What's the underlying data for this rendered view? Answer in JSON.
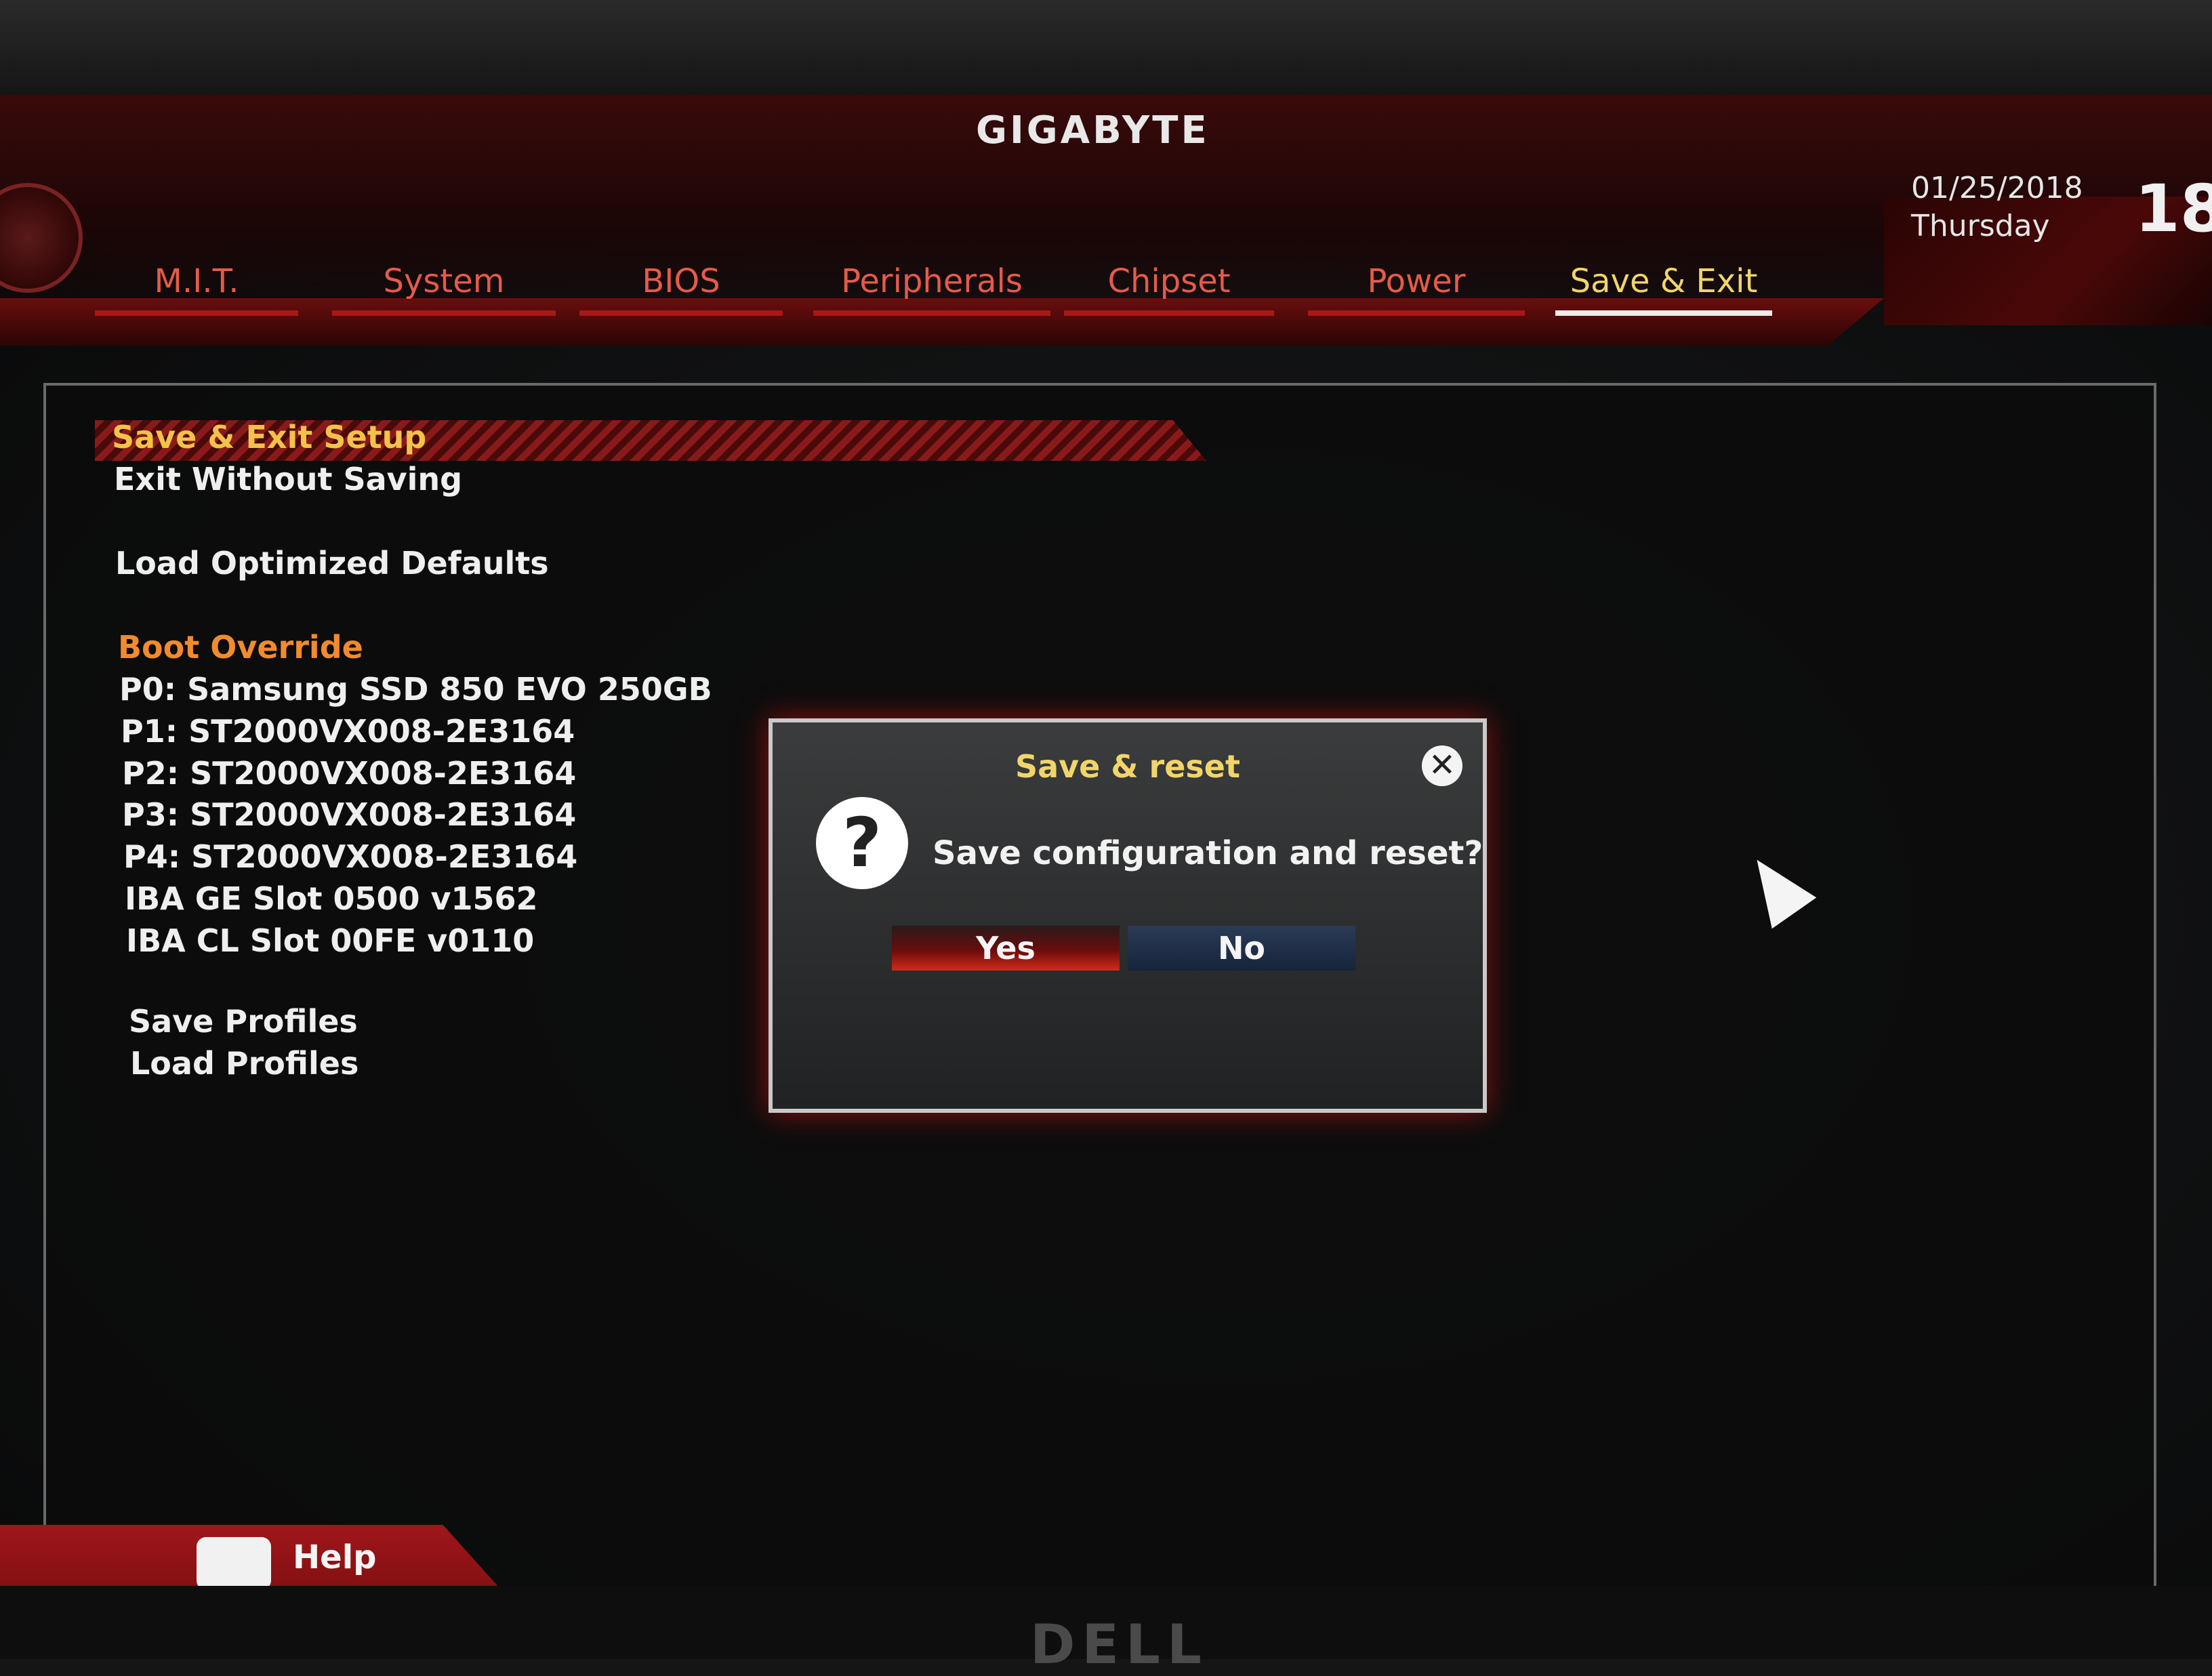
{
  "header": {
    "logo": "GIGABYTE",
    "date": "01/25/2018",
    "day": "Thursday",
    "time_fragment": "18"
  },
  "tabs": [
    {
      "label": "M.I.T."
    },
    {
      "label": "System"
    },
    {
      "label": "BIOS"
    },
    {
      "label": "Peripherals"
    },
    {
      "label": "Chipset"
    },
    {
      "label": "Power"
    },
    {
      "label": "Save & Exit"
    }
  ],
  "menu": {
    "save_exit_setup": "Save & Exit Setup",
    "exit_without_saving": "Exit Without Saving",
    "load_optimized_defaults": "Load Optimized Defaults",
    "boot_override_heading": "Boot Override",
    "boot_devices": [
      "P0: Samsung SSD 850 EVO 250GB",
      "P1: ST2000VX008-2E3164",
      "P2: ST2000VX008-2E3164",
      "P3: ST2000VX008-2E3164",
      "P4: ST2000VX008-2E3164",
      "IBA GE Slot 0500 v1562",
      "IBA CL Slot 00FE v0110"
    ],
    "save_profiles": "Save Profiles",
    "load_profiles": "Load Profiles"
  },
  "dialog": {
    "title": "Save & reset",
    "message": "Save configuration and reset?",
    "yes_label": "Yes",
    "no_label": "No",
    "question_glyph": "?",
    "close_glyph": "✕"
  },
  "footer": {
    "help_label": "Help"
  },
  "monitor": {
    "brand": "DELL"
  },
  "colors": {
    "accent_red": "#a81818",
    "active_tab": "#f2d56a",
    "section_heading": "#f28a2e"
  }
}
